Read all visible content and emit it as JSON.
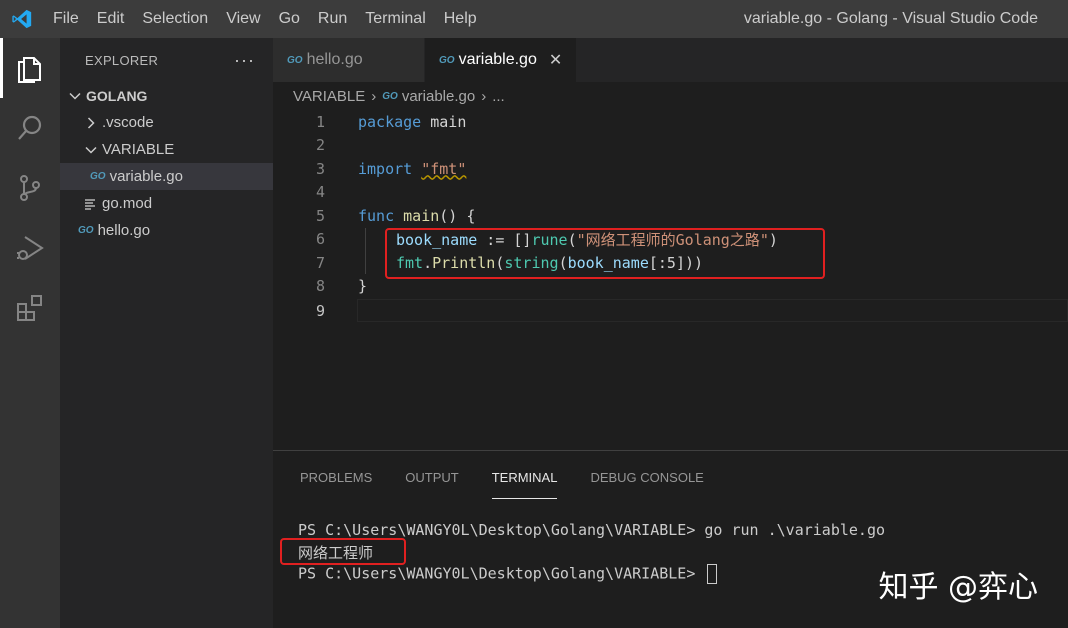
{
  "menu": [
    "File",
    "Edit",
    "Selection",
    "View",
    "Go",
    "Run",
    "Terminal",
    "Help"
  ],
  "window_title": "variable.go - Golang - Visual Studio Code",
  "activity_bar": [
    "explorer-icon",
    "search-icon",
    "source-control-icon",
    "run-debug-icon",
    "extensions-icon"
  ],
  "explorer": {
    "title": "EXPLORER",
    "more": "···",
    "workspace": "GOLANG",
    "items": [
      {
        "label": ".vscode",
        "type": "folder-collapsed"
      },
      {
        "label": "VARIABLE",
        "type": "folder-open"
      },
      {
        "label": "variable.go",
        "type": "go-file",
        "icon_text": "GO"
      },
      {
        "label": "go.mod",
        "type": "mod-file"
      },
      {
        "label": "hello.go",
        "type": "go-file",
        "icon_text": "GO"
      }
    ]
  },
  "tabs": [
    {
      "label": "hello.go",
      "icon_text": "GO"
    },
    {
      "label": "variable.go",
      "icon_text": "GO",
      "close": "✕"
    }
  ],
  "breadcrumb": {
    "folder": "VARIABLE",
    "sep": "›",
    "icon_text": "GO",
    "file": "variable.go",
    "more": "..."
  },
  "editor": {
    "line_numbers": [
      "1",
      "2",
      "3",
      "4",
      "5",
      "6",
      "7",
      "8",
      "9"
    ],
    "lines": {
      "l1": {
        "kw": "package",
        "rest": " main"
      },
      "l3": {
        "kw": "import",
        "sp": " ",
        "str": "\"fmt\""
      },
      "l5": {
        "kw": "func",
        "sp": " ",
        "fn": "main",
        "rest": "() {"
      },
      "l6": {
        "var": "book_name",
        "op": " := []",
        "ty": "rune",
        "p1": "(",
        "str": "\"网络工程师的Golang之路\"",
        "p2": ")"
      },
      "l7": {
        "var1": "fmt",
        "dot": ".",
        "fn": "Println",
        "p1": "(",
        "ty": "string",
        "p2": "(",
        "var2": "book_name",
        "rest": "[:5]))"
      },
      "l8": {
        "rest": "}"
      }
    }
  },
  "panel": {
    "tabs": [
      "PROBLEMS",
      "OUTPUT",
      "TERMINAL",
      "DEBUG CONSOLE"
    ],
    "active_tab": "TERMINAL",
    "terminal_lines": [
      "PS C:\\Users\\WANGY0L\\Desktop\\Golang\\VARIABLE> go run .\\variable.go",
      "网络工程师",
      "PS C:\\Users\\WANGY0L\\Desktop\\Golang\\VARIABLE> "
    ]
  },
  "watermark": "知乎 @弈心",
  "colors": {
    "highlight_box": "#e02020",
    "go_icon": "#519aba",
    "keyword": "#569cd6"
  }
}
